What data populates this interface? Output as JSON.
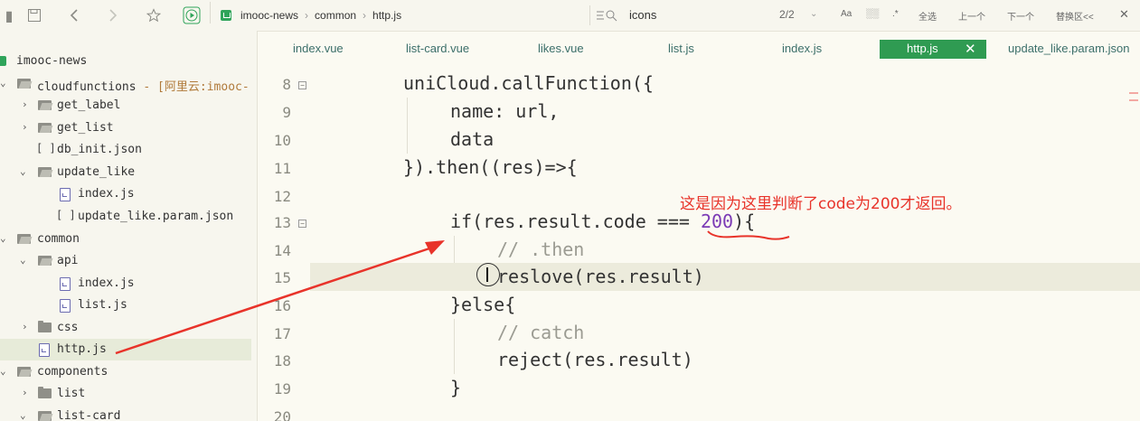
{
  "toolbar": {
    "breadcrumb": [
      "imooc-news",
      "common",
      "http.js"
    ],
    "search_query": "icons",
    "match_count": "2/2",
    "opt_case": "Aa",
    "opt_word": "░░",
    "select_all": "全选",
    "prev": "上一个",
    "next": "下一个",
    "replace": "替换区<<"
  },
  "sidebar": {
    "items": [
      {
        "label": "imooc-news",
        "icon": "uni-project-icon",
        "expanded": null
      },
      {
        "label": "cloudfunctions",
        "annotation": " - [阿里云:imooc-",
        "icon": "folder-open-icon",
        "expanded": true
      },
      {
        "label": "get_label",
        "icon": "folder-icon",
        "expanded": false
      },
      {
        "label": "get_list",
        "icon": "folder-icon",
        "expanded": false
      },
      {
        "label": "db_init.json",
        "icon": "json-icon"
      },
      {
        "label": "update_like",
        "icon": "folder-open-icon",
        "expanded": true
      },
      {
        "label": "index.js",
        "icon": "file-icon"
      },
      {
        "label": "update_like.param.json",
        "icon": "json-icon"
      },
      {
        "label": "common",
        "icon": "folder-open-icon",
        "expanded": true
      },
      {
        "label": "api",
        "icon": "folder-open-icon",
        "expanded": true
      },
      {
        "label": "index.js",
        "icon": "file-icon"
      },
      {
        "label": "list.js",
        "icon": "file-icon"
      },
      {
        "label": "css",
        "icon": "folder-icon",
        "expanded": false
      },
      {
        "label": "http.js",
        "icon": "file-icon",
        "selected": true
      },
      {
        "label": "components",
        "icon": "folder-open-icon",
        "expanded": true
      },
      {
        "label": "list",
        "icon": "folder-icon",
        "expanded": false
      },
      {
        "label": "list-card",
        "icon": "folder-open-icon",
        "expanded": true
      }
    ]
  },
  "tabs": [
    {
      "label": "index.vue"
    },
    {
      "label": "list-card.vue"
    },
    {
      "label": "likes.vue"
    },
    {
      "label": "list.js"
    },
    {
      "label": "index.js"
    },
    {
      "label": "http.js",
      "active": true,
      "close": "✕"
    },
    {
      "label": "update_like.param.json"
    }
  ],
  "editor": {
    "lines": [
      {
        "n": "8",
        "text": "uniCloud.callFunction({"
      },
      {
        "n": "9",
        "text": "name: url,"
      },
      {
        "n": "10",
        "text": "data"
      },
      {
        "n": "11",
        "text": "}).then((res)=>{"
      },
      {
        "n": "12",
        "text": ""
      },
      {
        "n": "13",
        "pre": "if(res.result.code === ",
        "num": "200",
        "post": "){"
      },
      {
        "n": "14",
        "text": "// .then"
      },
      {
        "n": "15",
        "text": "reslove(res.result)"
      },
      {
        "n": "16",
        "text": "}else{"
      },
      {
        "n": "17",
        "text": "// catch"
      },
      {
        "n": "18",
        "text": "reject(res.result)"
      },
      {
        "n": "19",
        "text": "}"
      },
      {
        "n": "20",
        "text": ""
      }
    ]
  },
  "annotation": {
    "text": "这是因为这里判断了code为200才返回。",
    "color": "#e8332a"
  },
  "colors": {
    "accent": "#2f9b52",
    "background": "#fbfaf2",
    "number": "#7b3ab5"
  }
}
